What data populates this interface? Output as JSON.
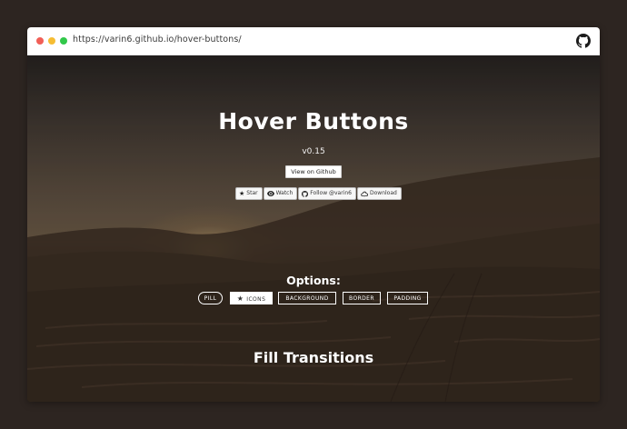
{
  "browser": {
    "url": "https://varin6.github.io/hover-buttons/",
    "github_icon": "github-icon"
  },
  "hero": {
    "title": "Hover Buttons",
    "version": "v0.15",
    "view_button": "View on Github",
    "social": {
      "star": "Star",
      "watch": "Watch",
      "follow": "Follow @varin6",
      "download": "Download"
    },
    "options_label": "Options:",
    "options": {
      "pill": "PILL",
      "icons": "ICONS",
      "background": "BACKGROUND",
      "border": "BORDER",
      "padding": "PADDING"
    },
    "section_title": "Fill Transitions"
  }
}
